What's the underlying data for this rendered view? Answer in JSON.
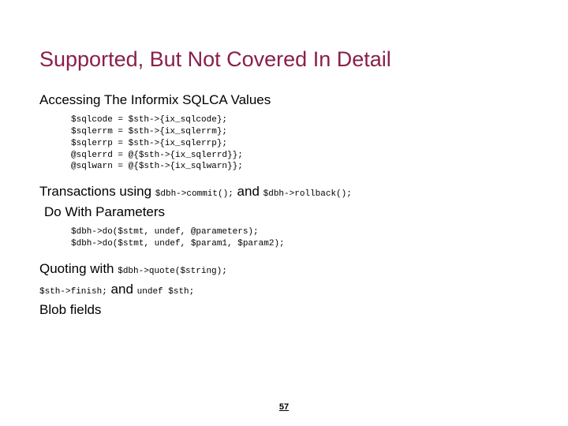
{
  "title": "Supported, But Not Covered In Detail",
  "sec1": {
    "heading": "Accessing The Informix SQLCA Values",
    "code": "$sqlcode = $sth->{ix_sqlcode};\n$sqlerrm = $sth->{ix_sqlerrm};\n$sqlerrp = $sth->{ix_sqlerrp};\n@sqlerrd = @{$sth->{ix_sqlerrd}};\n@sqlwarn = @{$sth->{ix_sqlwarn}};"
  },
  "sec2": {
    "pre": "Transactions using ",
    "code1": "$dbh->commit();",
    "mid": " and ",
    "code2": "$dbh->rollback();"
  },
  "sec3": {
    "heading": "Do With Parameters",
    "code": "$dbh->do($stmt, undef, @parameters);\n$dbh->do($stmt, undef, $param1, $param2);"
  },
  "sec4": {
    "pre": "Quoting with ",
    "code": "$dbh->quote($string);"
  },
  "sec5": {
    "code1": "$sth->finish;",
    "mid": " and ",
    "code2": "undef $sth;"
  },
  "sec6": {
    "heading": "Blob fields"
  },
  "page": "57"
}
